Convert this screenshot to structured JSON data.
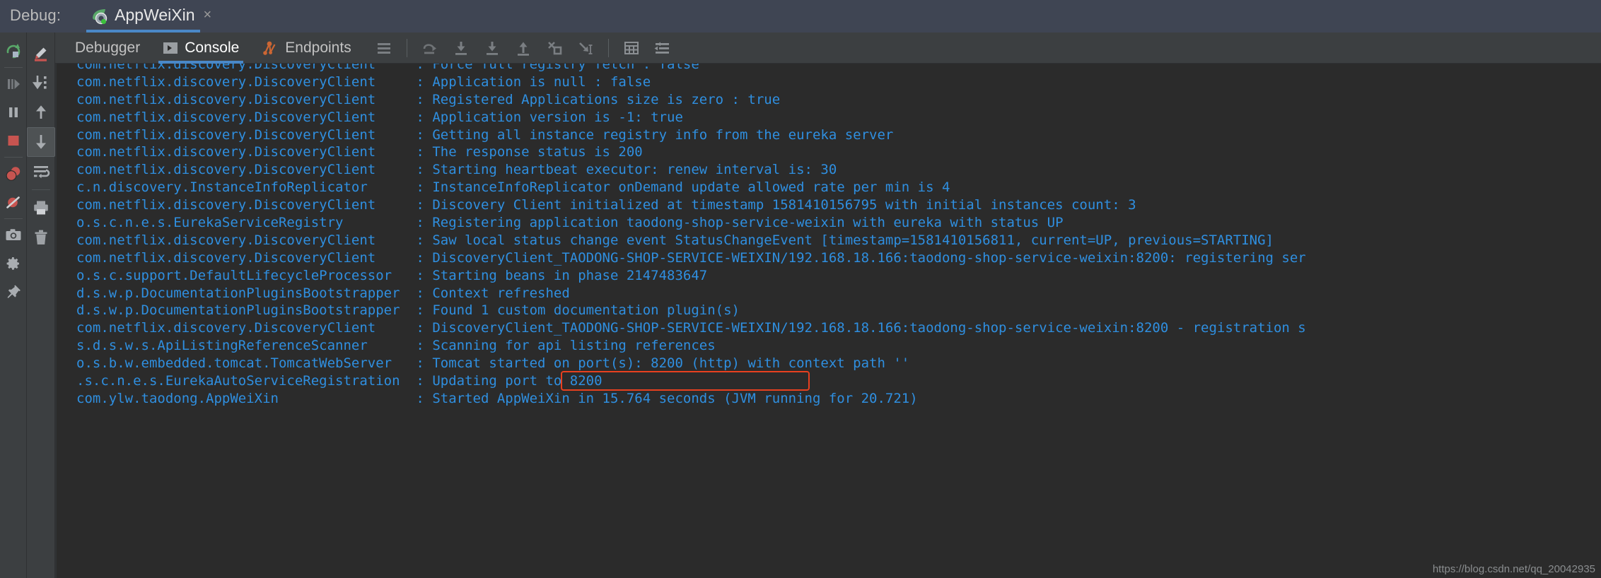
{
  "titlebar": {
    "label": "Debug:",
    "tab_title": "AppWeiXin",
    "close": "×",
    "tab_icon": "spring-boot-leaf-icon"
  },
  "run_controls": [
    {
      "name": "rerun-button",
      "icon": "rerun-icon",
      "title": "Rerun"
    },
    {
      "name": "resume-program-button",
      "icon": "resume-icon",
      "title": "Resume Program"
    },
    {
      "name": "pause-program-button",
      "icon": "pause-icon",
      "title": "Pause Program"
    },
    {
      "name": "stop-button",
      "icon": "stop-icon",
      "title": "Stop"
    },
    {
      "name": "view-breakpoints-button",
      "icon": "breakpoints-icon",
      "title": "View Breakpoints"
    },
    {
      "name": "mute-breakpoints-button",
      "icon": "mute-breakpoints-icon",
      "title": "Mute Breakpoints"
    },
    {
      "name": "screenshot-button",
      "icon": "camera-icon",
      "title": "Screenshot"
    },
    {
      "name": "settings-button",
      "icon": "gear-icon",
      "title": "Settings"
    },
    {
      "name": "pin-tab-button",
      "icon": "pin-icon",
      "title": "Pin Tab"
    }
  ],
  "console_controls": [
    {
      "name": "highlight-button",
      "icon": "highlighter-pen-icon",
      "title": "Highlight"
    },
    {
      "name": "scroll-to-end-button",
      "icon": "scroll-to-end-icon",
      "title": "Scroll to the end"
    },
    {
      "name": "up-button",
      "icon": "arrow-up-icon",
      "title": "Up the Stack Trace"
    },
    {
      "name": "down-button",
      "icon": "arrow-down-icon",
      "title": "Down the Stack Trace"
    },
    {
      "name": "soft-wrap-button",
      "icon": "soft-wrap-icon",
      "title": "Use Soft Wraps"
    },
    {
      "name": "print-button",
      "icon": "printer-icon",
      "title": "Print"
    },
    {
      "name": "clear-all-button",
      "icon": "trash-icon",
      "title": "Clear All"
    }
  ],
  "toolbar": {
    "tabs": [
      {
        "label": "Debugger",
        "icon": null,
        "active": false
      },
      {
        "label": "Console",
        "icon": "console-prompt-icon",
        "active": true
      },
      {
        "label": "Endpoints",
        "icon": "endpoints-icon",
        "active": false
      }
    ],
    "icons": [
      {
        "name": "layout-settings-icon"
      },
      {
        "name": "step-out-over-icon"
      },
      {
        "name": "step-into-icon"
      },
      {
        "name": "force-step-into-icon"
      },
      {
        "name": "step-out-icon"
      },
      {
        "name": "drop-frame-icon"
      },
      {
        "name": "run-to-cursor-icon"
      },
      {
        "name": "evaluate-expression-icon"
      },
      {
        "name": "settings-list-icon"
      }
    ]
  },
  "console": {
    "lines": [
      {
        "logger": "com.netflix.discovery.DiscoveryClient",
        "message": ": Force full registry fetch : false",
        "clipped": true
      },
      {
        "logger": "com.netflix.discovery.DiscoveryClient",
        "message": ": Application is null : false"
      },
      {
        "logger": "com.netflix.discovery.DiscoveryClient",
        "message": ": Registered Applications size is zero : true"
      },
      {
        "logger": "com.netflix.discovery.DiscoveryClient",
        "message": ": Application version is -1: true"
      },
      {
        "logger": "com.netflix.discovery.DiscoveryClient",
        "message": ": Getting all instance registry info from the eureka server"
      },
      {
        "logger": "com.netflix.discovery.DiscoveryClient",
        "message": ": The response status is 200"
      },
      {
        "logger": "com.netflix.discovery.DiscoveryClient",
        "message": ": Starting heartbeat executor: renew interval is: 30"
      },
      {
        "logger": "c.n.discovery.InstanceInfoReplicator",
        "message": ": InstanceInfoReplicator onDemand update allowed rate per min is 4"
      },
      {
        "logger": "com.netflix.discovery.DiscoveryClient",
        "message": ": Discovery Client initialized at timestamp 1581410156795 with initial instances count: 3"
      },
      {
        "logger": "o.s.c.n.e.s.EurekaServiceRegistry",
        "message": ": Registering application taodong-shop-service-weixin with eureka with status UP"
      },
      {
        "logger": "com.netflix.discovery.DiscoveryClient",
        "message": ": Saw local status change event StatusChangeEvent [timestamp=1581410156811, current=UP, previous=STARTING]"
      },
      {
        "logger": "com.netflix.discovery.DiscoveryClient",
        "message": ": DiscoveryClient_TAODONG-SHOP-SERVICE-WEIXIN/192.168.18.166:taodong-shop-service-weixin:8200: registering ser"
      },
      {
        "logger": "o.s.c.support.DefaultLifecycleProcessor",
        "message": ": Starting beans in phase 2147483647"
      },
      {
        "logger": "d.s.w.p.DocumentationPluginsBootstrapper",
        "message": ": Context refreshed"
      },
      {
        "logger": "d.s.w.p.DocumentationPluginsBootstrapper",
        "message": ": Found 1 custom documentation plugin(s)"
      },
      {
        "logger": "com.netflix.discovery.DiscoveryClient",
        "message": ": DiscoveryClient_TAODONG-SHOP-SERVICE-WEIXIN/192.168.18.166:taodong-shop-service-weixin:8200 - registration s"
      },
      {
        "logger": "s.d.s.w.s.ApiListingReferenceScanner",
        "message": ": Scanning for api listing references"
      },
      {
        "logger": "o.s.b.w.embedded.tomcat.TomcatWebServer",
        "message": ": Tomcat started on port(s): 8200 (http) with context path ''"
      },
      {
        "logger": ".s.c.n.e.s.EurekaAutoServiceRegistration",
        "message": ": Updating port to 8200",
        "highlighted": true
      },
      {
        "logger": "com.ylw.taodong.AppWeiXin",
        "message": ": Started AppWeiXin in 15.764 seconds (JVM running for 20.721)"
      }
    ],
    "logger_column_width_chars": 42
  },
  "watermark": "https://blog.csdn.net/qq_20042935",
  "colors": {
    "log_text": "#2f8fe0",
    "console_bg": "#2b2b2b",
    "chrome_bg": "#3c3f41",
    "titlebar_bg": "#3f4553",
    "accent_tab": "#4a88c7",
    "highlight_border": "#e8401f",
    "stop_red": "#c75450",
    "rerun_green": "#59a869",
    "endpoints_orange": "#cc6633"
  }
}
